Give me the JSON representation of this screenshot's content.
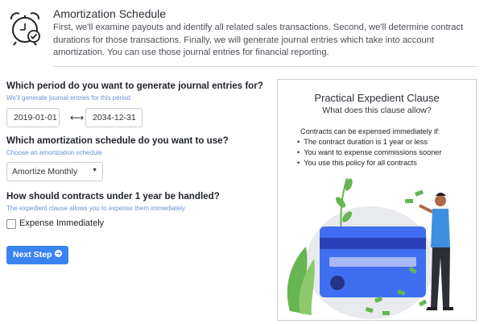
{
  "header": {
    "title": "Amortization Schedule",
    "description": "First, we'll examine payouts and identify all related sales transactions. Second, we'll determine contract durations for those transactions. Finally, we will generate journal entries which take into account amortization. You can use those journal entries for financial reporting.",
    "icon": "alarm-clock-check-icon"
  },
  "period": {
    "question": "Which period do you want to generate journal entries for?",
    "hint": "We'll generate journal entries for this period",
    "start_date": "2019-01-01",
    "end_date": "2034-12-31",
    "separator": "⟷"
  },
  "schedule": {
    "question": "Which amortization schedule do you want to use?",
    "hint": "Choose an amortization schedule",
    "selected": "Amortize Monthly"
  },
  "short_contracts": {
    "question": "How should contracts under 1 year be handled?",
    "hint": "The expedient clause allows you to expense them immediately",
    "checkbox_label": "Expense Immediately",
    "checked": false
  },
  "next_button": {
    "label": "Next Step"
  },
  "card": {
    "title": "Practical Expedient Clause",
    "subtitle": "What does this clause allow?",
    "intro": "Contracts can be expensed immediately if:",
    "bullets": [
      "The contract duration is 1 year or less",
      "You want to expense commissions sooner",
      "You use this policy for all contracts"
    ]
  },
  "colors": {
    "accent": "#3a84f0",
    "hint": "#6c8fd6",
    "card_blue": "#3f6ff0",
    "plant_green": "#66b552"
  }
}
